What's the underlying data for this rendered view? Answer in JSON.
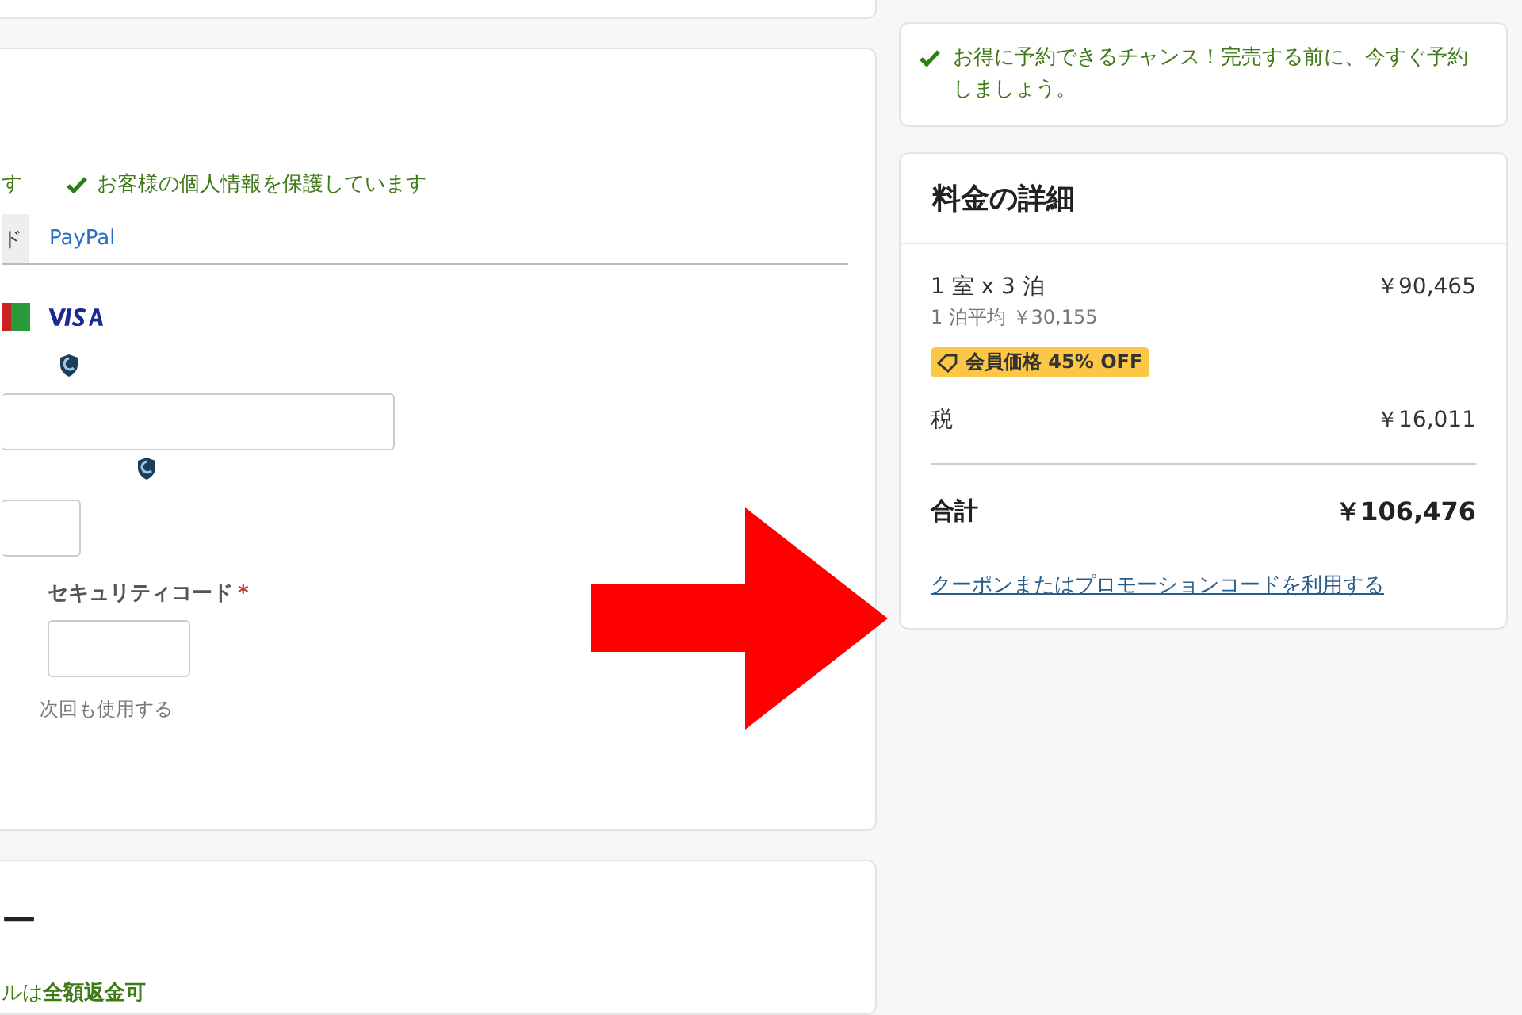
{
  "payment": {
    "notices": [
      "す",
      "お客様の個人情報を保護しています"
    ],
    "tabs": [
      {
        "label": "ド",
        "selected": true
      },
      {
        "label": "PayPal",
        "selected": false
      }
    ],
    "security_code": {
      "label": "セキュリティコード",
      "required_mark": "*"
    },
    "remember": "次回も使用する"
  },
  "cancellation": {
    "heading": "ー",
    "policy": "ルは**全額返金可**"
  },
  "alert": "お得に予約できるチャンス！完売する前に、今すぐ予約しましょう。",
  "price_details": {
    "title": "料金の詳細",
    "lines": [
      {
        "label": "1 室 x 3 泊",
        "amount": "￥90,465",
        "note": "1 泊平均 ￥30,155",
        "badge": "会員価格 45% OFF"
      },
      {
        "label": "税",
        "amount": "￥16,011"
      }
    ],
    "total": {
      "label": "合計",
      "amount": "￥106,476"
    },
    "coupon_link": "クーポンまたはプロモーションコードを利用する"
  }
}
